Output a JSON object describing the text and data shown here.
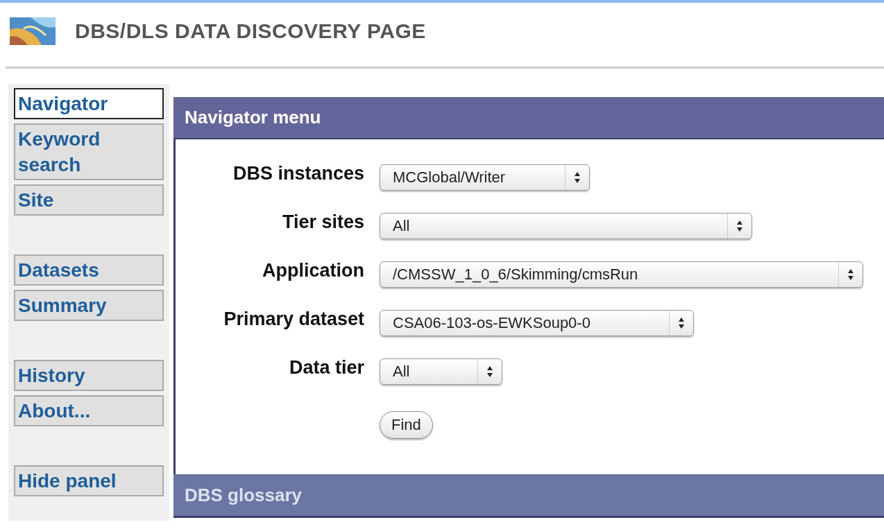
{
  "header": {
    "title": "DBS/DLS DATA DISCOVERY PAGE"
  },
  "sidebar": {
    "groups": [
      [
        {
          "label": "Navigator",
          "selected": true
        },
        {
          "label": "Keyword search",
          "selected": false
        },
        {
          "label": "Site",
          "selected": false
        }
      ],
      [
        {
          "label": "Datasets",
          "selected": false
        },
        {
          "label": "Summary",
          "selected": false
        }
      ],
      [
        {
          "label": "History",
          "selected": false
        },
        {
          "label": "About...",
          "selected": false
        }
      ],
      [
        {
          "label": "Hide panel",
          "selected": false
        }
      ]
    ]
  },
  "navigator_menu": {
    "title": "Navigator menu",
    "fields": [
      {
        "label": "DBS instances",
        "value": "MCGlobal/Writer"
      },
      {
        "label": "Tier sites",
        "value": "All"
      },
      {
        "label": "Application",
        "value": "/CMSSW_1_0_6/Skimming/cmsRun"
      },
      {
        "label": "Primary dataset",
        "value": "CSA06-103-os-EWKSoup0-0"
      },
      {
        "label": "Data tier",
        "value": "All"
      }
    ],
    "button": "Find"
  },
  "glossary": {
    "title": "DBS glossary"
  }
}
